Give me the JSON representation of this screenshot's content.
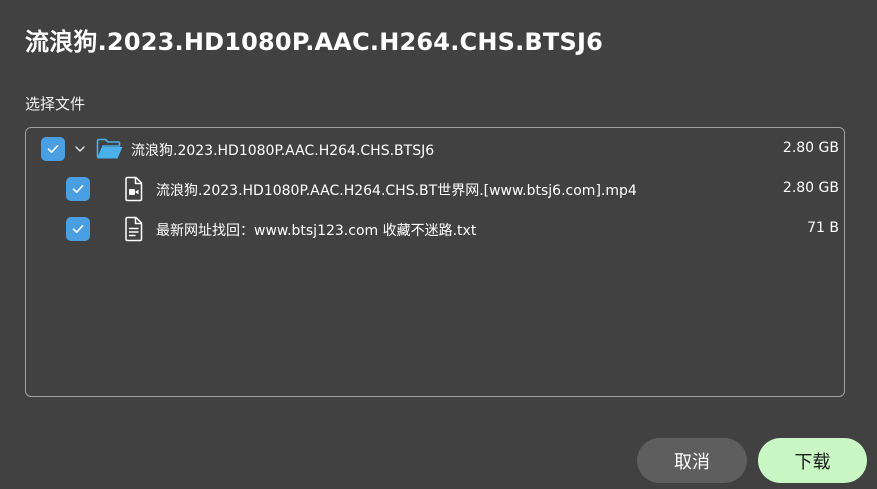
{
  "dialog": {
    "title": "流浪狗.2023.HD1080P.AAC.H264.CHS.BTSJ6",
    "section_label": "选择文件"
  },
  "file_tree": {
    "folder": {
      "name": "流浪狗.2023.HD1080P.AAC.H264.CHS.BTSJ6",
      "size": "2.80 GB",
      "checked": true,
      "expanded": true,
      "icon": "folder-open-icon"
    },
    "files": [
      {
        "name": "流浪狗.2023.HD1080P.AAC.H264.CHS.BT世界网.[www.btsj6.com].mp4",
        "size": "2.80 GB",
        "checked": true,
        "icon": "video-file-icon"
      },
      {
        "name": "最新网址找回：www.btsj123.com 收藏不迷路.txt",
        "size": "71 B",
        "checked": true,
        "icon": "text-file-icon"
      }
    ]
  },
  "buttons": {
    "cancel_label": "取消",
    "download_label": "下载"
  },
  "colors": {
    "background": "#414141",
    "checkbox": "#4a9fe3",
    "folder_icon": "#4ab0ea",
    "cancel_button": "#5e5e5e",
    "download_button": "#c8f7c4"
  }
}
